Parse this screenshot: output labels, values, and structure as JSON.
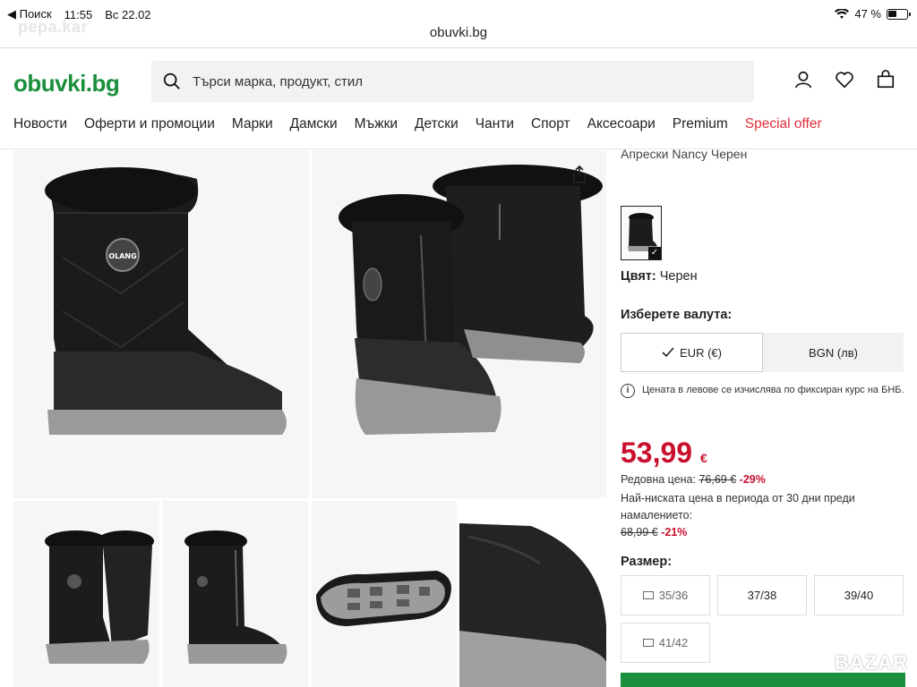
{
  "status_bar": {
    "back_app": "◀ Поиск",
    "time": "11:55",
    "date": "Вс 22.02",
    "battery": "47 %"
  },
  "watermark_top": "pepa.kar",
  "browser": {
    "url": "obuvki.bg"
  },
  "header": {
    "logo_main": "obuvki",
    "logo_tld": ".bg",
    "search_placeholder": "Търси марка, продукт, стил",
    "icons": [
      "user-icon",
      "heart-icon",
      "bag-icon"
    ]
  },
  "nav": {
    "items": [
      "Новости",
      "Оферти и промоции",
      "Марки",
      "Дамски",
      "Мъжки",
      "Детски",
      "Чанти",
      "Спорт",
      "Аксесоари",
      "Premium",
      "Special offer"
    ],
    "special_color": "#e0303c"
  },
  "product": {
    "title": "Апрески Nancy Черен",
    "color_label": "Цвят:",
    "color_value": "Черен",
    "currency_label": "Изберете валута:",
    "currency_options": [
      "EUR (€)",
      "BGN (лв)"
    ],
    "currency_selected": "EUR (€)",
    "info_text": "Цената в левове се изчислява по фиксиран курс на БНБ.",
    "price": "53,99",
    "price_currency": "€",
    "regular_label": "Редовна цена:",
    "regular_price": "76,69 €",
    "regular_discount": "-29%",
    "lowest_text": "Най-ниската цена в периода от 30 дни преди намалението:",
    "lowest_price": "68,99 €",
    "lowest_discount": "-21%",
    "size_label": "Размер:",
    "sizes": [
      {
        "label": "35/36",
        "notify": true
      },
      {
        "label": "37/38",
        "notify": false
      },
      {
        "label": "39/40",
        "notify": false
      },
      {
        "label": "41/42",
        "notify": true
      }
    ],
    "brand_badge": "OLANG",
    "price_color": "#c8102e",
    "accent_color": "#1a8f3c"
  },
  "watermark_bottom": "BAZAR"
}
